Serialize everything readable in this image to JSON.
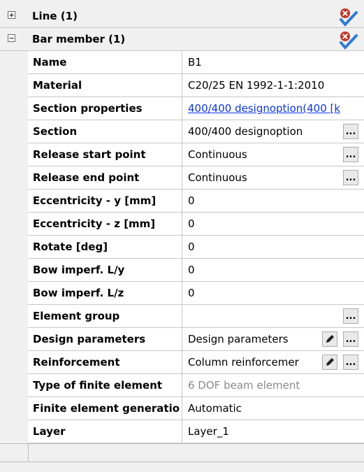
{
  "groups": [
    {
      "label": "Line (1)",
      "expander": "+",
      "expander_icon": "plus-expander",
      "state": "collapsed"
    },
    {
      "label": "Bar member (1)",
      "expander": "−",
      "expander_icon": "minus-expander",
      "state": "expanded"
    }
  ],
  "status_icon": "error-check-icon",
  "properties": [
    {
      "name": "Name",
      "value": "B1"
    },
    {
      "name": "Material",
      "value": "C20/25 EN 1992-1-1:2010"
    },
    {
      "name": "Section properties",
      "value": "400/400 designoption(400 [k"
    },
    {
      "name": "Section",
      "value": "400/400 designoption",
      "button": "..."
    },
    {
      "name": "Release start point",
      "value": "Continuous",
      "button": "..."
    },
    {
      "name": "Release end point",
      "value": "Continuous",
      "button": "..."
    },
    {
      "name": "Eccentricity - y [mm]",
      "value": "0"
    },
    {
      "name": "Eccentricity - z [mm]",
      "value": "0"
    },
    {
      "name": "Rotate [deg]",
      "value": "0"
    },
    {
      "name": "Bow imperf. L/y",
      "value": "0"
    },
    {
      "name": "Bow imperf. L/z",
      "value": "0"
    },
    {
      "name": "Element group",
      "value": "",
      "button": "..."
    },
    {
      "name": "Design parameters",
      "value": "Design parameters",
      "button": "...",
      "edit": "pencil-icon"
    },
    {
      "name": "Reinforcement",
      "value": "Column reinforcemer",
      "button": "...",
      "edit": "pencil-icon"
    },
    {
      "name": "Type of finite element",
      "value": "6 DOF beam element"
    },
    {
      "name": "Finite element generatio",
      "value": "Automatic"
    },
    {
      "name": "Layer",
      "value": "Layer_1"
    }
  ],
  "colors": {
    "link": "#0a35e8",
    "readonly": "#8a8a8a",
    "error": "#c0392b",
    "check": "#2f7bd6"
  }
}
